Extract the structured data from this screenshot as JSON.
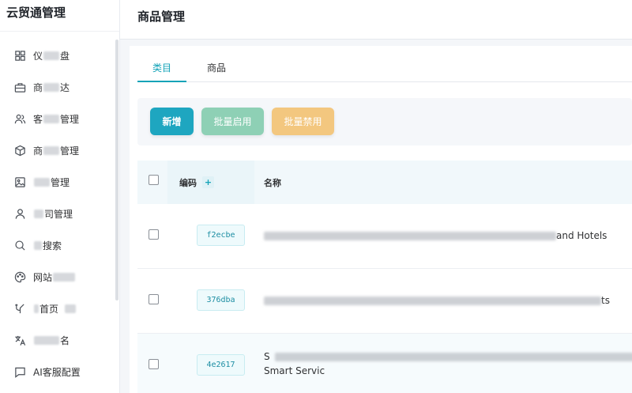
{
  "app": {
    "title": "云贸通管理"
  },
  "sidebar": {
    "items": [
      {
        "icon": "dashboard-icon",
        "prefix": "仪",
        "suffix": "盘"
      },
      {
        "icon": "briefcase-icon",
        "prefix": "商",
        "suffix": "达"
      },
      {
        "icon": "users-icon",
        "prefix": "客",
        "suffix": "管理"
      },
      {
        "icon": "box-icon",
        "prefix": "商",
        "suffix": "管理"
      },
      {
        "icon": "image-icon",
        "prefix": "",
        "suffix": "管理"
      },
      {
        "icon": "user-icon",
        "prefix": "",
        "suffix": "司管理"
      },
      {
        "icon": "search-icon",
        "prefix": "",
        "suffix": "搜索"
      },
      {
        "icon": "palette-icon",
        "prefix": "",
        "suffix": "网站"
      },
      {
        "icon": "branch-icon",
        "prefix": "",
        "suffix": "首页"
      },
      {
        "icon": "translate-icon",
        "prefix": "",
        "suffix": "名"
      },
      {
        "icon": "chat-icon",
        "prefix": "AI客服配置",
        "suffix": ""
      }
    ]
  },
  "header": {
    "title": "商品管理"
  },
  "tabs": [
    {
      "label": "类目"
    },
    {
      "label": "商品"
    }
  ],
  "toolbar": {
    "new_label": "新增",
    "enable_label": "批量启用",
    "disable_label": "批量禁用"
  },
  "table": {
    "columns": {
      "code": "编码",
      "plus": "+",
      "name": "名称"
    },
    "rows": [
      {
        "code": "f2ecbe",
        "name_tail": "and Hotels",
        "name_line2": ""
      },
      {
        "code": "376dba",
        "name_tail": "ts",
        "name_line2": ""
      },
      {
        "code": "4e2617",
        "name_tail": "S",
        "name_line2": "Smart Servic"
      }
    ]
  },
  "colors": {
    "accent": "#14a3b8",
    "btn_new": "#1ea6c0",
    "btn_enable": "#8ed0b5",
    "btn_disable": "#f3c77f"
  }
}
